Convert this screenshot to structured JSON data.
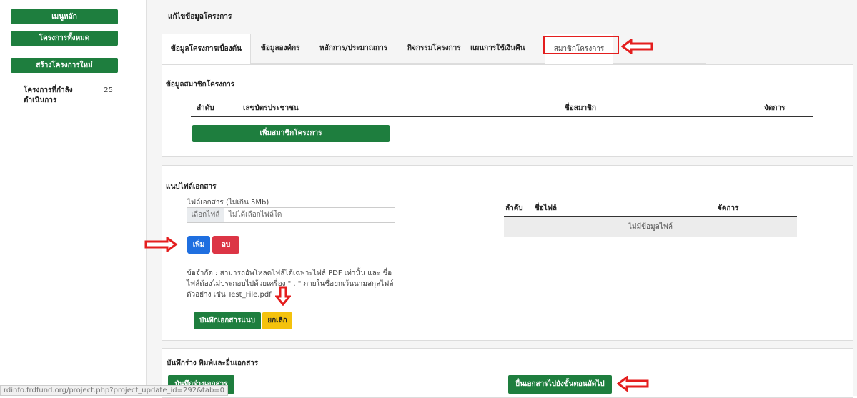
{
  "sidebar": {
    "main_menu": "เมนูหลัก",
    "all_projects": "โครงการทั้งหมด",
    "create_project": "สร้างโครงการใหม่",
    "in_progress_label": "โครงการที่กำลัง ดำเนินการ",
    "in_progress_count": "25"
  },
  "page": {
    "title": "แก้ไขข้อมูลโครงการ"
  },
  "tabs": [
    "ข้อมูลโครงการเบื้องต้น",
    "ข้อมูลองค์กร",
    "หลักการ/ประมาณการ",
    "กิจกรรมโครงการ",
    "แผนการใช้เงินคืน",
    "สมาชิกโครงการ"
  ],
  "members": {
    "title": "ข้อมูลสมาชิกโครงการ",
    "headers": [
      "ลำดับ",
      "เลขบัตรประชาชน",
      "ชื่อสมาชิก",
      "จัดการ"
    ],
    "add_button": "เพิ่มสมาชิกโครงการ"
  },
  "attach": {
    "title": "แนบไฟล์เอกสาร",
    "field_label": "ไฟล์เอกสาร (ไม่เกิน 5Mb)",
    "choose_label": "เลือกไฟล์",
    "no_file": "ไม่ได้เลือกไฟล์ใด",
    "add_button": "เพิ่ม",
    "delete_button": "ลบ",
    "note": "ข้อจำกัด : สามารถอัพโหลดไฟล์ได้เฉพาะไฟล์ PDF เท่านั้น และ ชื่อไฟล์ต้องไม่ประกอบไปด้วยเครื่อง \" . \" ภายในชื่อยกเว้นนามสกุลไฟล์ตัวอย่าง เช่น Test_File.pdf",
    "save_button": "บันทึกเอกสารแนบ",
    "cancel_button": "ยกเลิก",
    "table_headers": [
      "ลำดับ",
      "ชื่อไฟล์",
      "จัดการ"
    ],
    "empty_text": "ไม่มีข้อมูลไฟล์"
  },
  "submit": {
    "title": "บันทึกร่าง พิมพ์และยื่นเอกสาร",
    "save_draft": "บันทึกร่างเอกสาร",
    "submit_next": "ยื่นเอกสารไปยังขั้นตอนถัดไป"
  },
  "status_url": "rdinfo.frdfund.org/project.php?project_update_id=292&tab=0",
  "colors": {
    "green": "#1e7e3e",
    "blue": "#1f6fe0",
    "red": "#dc3545",
    "yellow": "#f4c20d",
    "annotation": "#e41e1e"
  }
}
